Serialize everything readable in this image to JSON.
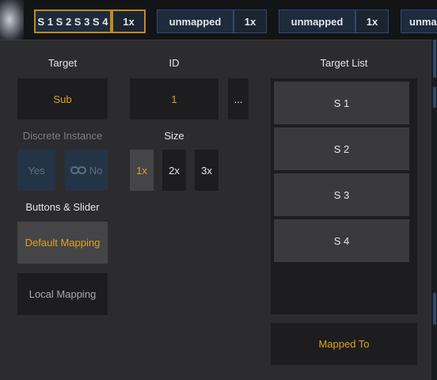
{
  "topbar": {
    "chips": [
      {
        "label": "S 1 S 2 S 3 S 4",
        "size": "1x",
        "selected": true
      },
      {
        "label": "unmapped",
        "size": "1x",
        "selected": false
      },
      {
        "label": "unmapped",
        "size": "1x",
        "selected": false
      },
      {
        "label": "unma",
        "size": "",
        "selected": false
      }
    ]
  },
  "target": {
    "heading": "Target",
    "value": "Sub"
  },
  "id": {
    "heading": "ID",
    "value": "1",
    "more_label": "..."
  },
  "discrete": {
    "heading": "Discrete Instance",
    "yes_label": "Yes",
    "no_label": "No"
  },
  "size": {
    "heading": "Size",
    "options": [
      "1x",
      "2x",
      "3x"
    ],
    "selected": "1x"
  },
  "buttons_slider": {
    "heading": "Buttons & Slider",
    "default_label": "Default Mapping",
    "local_label": "Local Mapping"
  },
  "target_list": {
    "heading": "Target List",
    "items": [
      "S 1",
      "S 2",
      "S 3",
      "S 4"
    ]
  },
  "mapped_to": {
    "label": "Mapped To"
  },
  "colors": {
    "accent": "#e0a020",
    "selection_border": "#c08a1c",
    "chip_blue": "#1d2b3c"
  }
}
